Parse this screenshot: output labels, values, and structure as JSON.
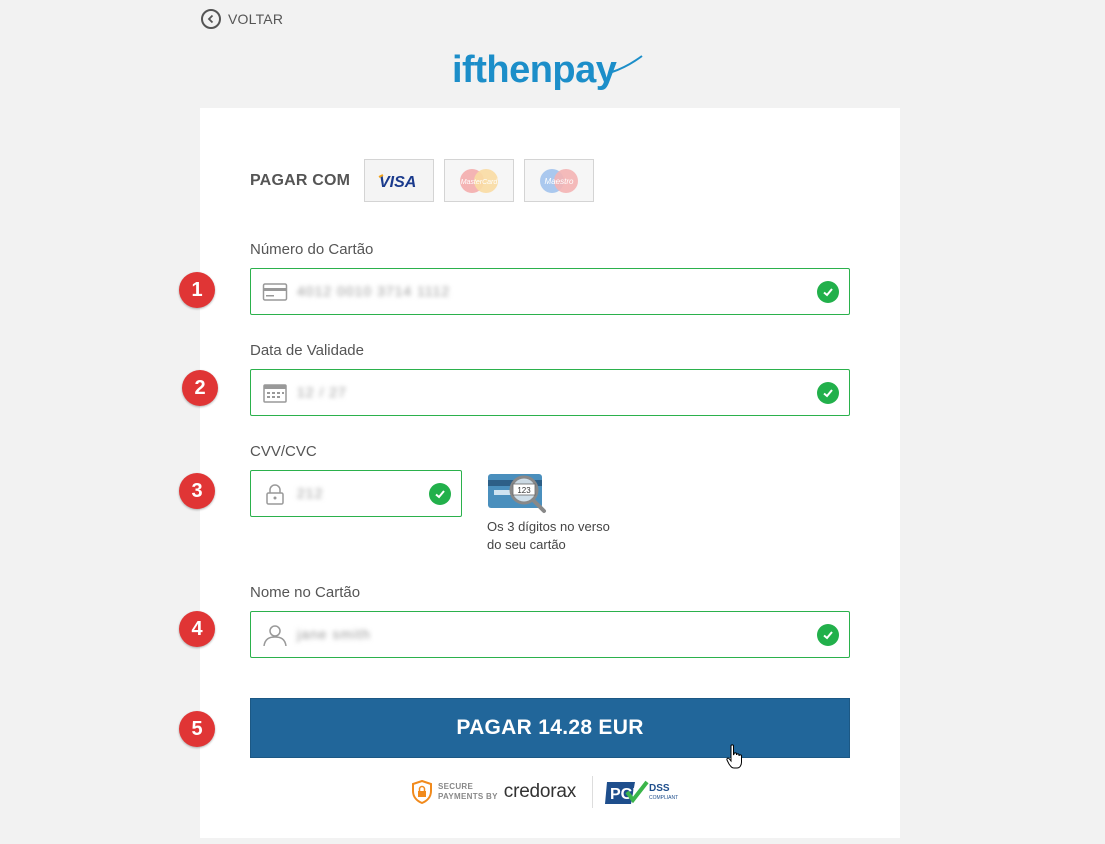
{
  "back": {
    "label": "VOLTAR"
  },
  "logo": {
    "text": "ifthenpay",
    "color": "#1c8ec9"
  },
  "payment": {
    "pay_with_label": "PAGAR COM",
    "brands": [
      "VISA",
      "MasterCard",
      "Maestro"
    ]
  },
  "fields": {
    "card_number": {
      "label": "Número do Cartão",
      "value": "4012 0010 3714 1112",
      "icon": "credit-card-icon",
      "valid": true
    },
    "expiry": {
      "label": "Data de Validade",
      "value": "12 / 27",
      "icon": "calendar-icon",
      "valid": true
    },
    "cvv": {
      "label": "CVV/CVC",
      "value": "212",
      "icon": "lock-icon",
      "valid": true
    },
    "name": {
      "label": "Nome no Cartão",
      "value": "jane smith",
      "icon": "user-icon",
      "valid": true
    }
  },
  "cvv_help": {
    "badge": "123",
    "text": "Os 3 dígitos no verso do seu cartão"
  },
  "pay_button": {
    "label": "PAGAR 14.28 EUR"
  },
  "steps": [
    "1",
    "2",
    "3",
    "4",
    "5"
  ],
  "secure": {
    "line1": "SECURE",
    "line2": "PAYMENTS BY",
    "provider": "credorax",
    "pci_text": "PCI",
    "dss_text": "DSS",
    "compliant_text": "COMPLIANT"
  },
  "colors": {
    "accent": "#21669a",
    "valid": "#22b04b",
    "step": "#e03535",
    "logo": "#1c8ec9"
  }
}
